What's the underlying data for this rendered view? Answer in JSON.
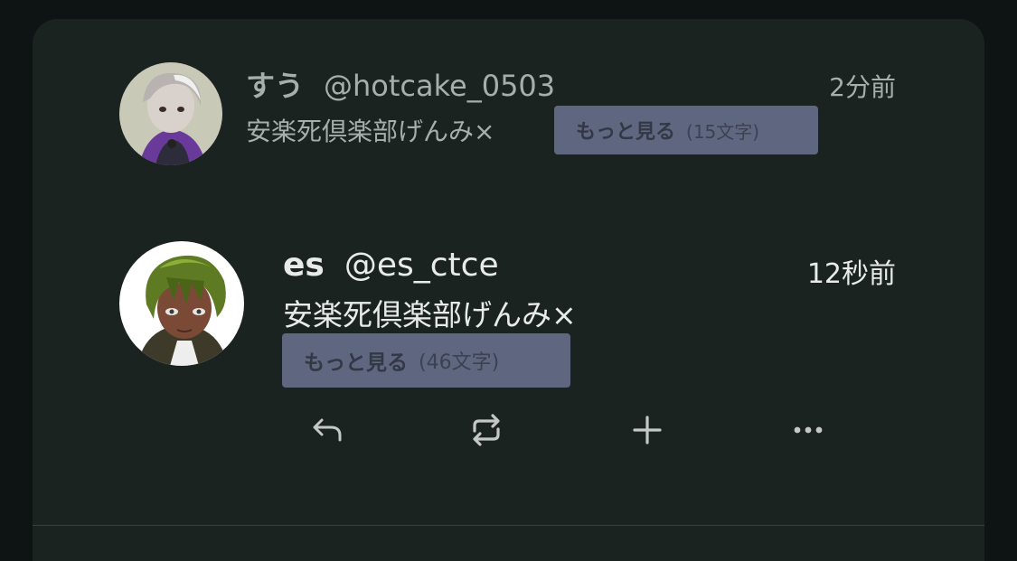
{
  "posts": [
    {
      "display_name": "すう",
      "handle": "@hotcake_0503",
      "time": "2分前",
      "text": "安楽死倶楽部げんみ×",
      "more_label": "もっと見る",
      "more_count": "(15文字)",
      "avatar_icon": "user-avatar-purple-jacket"
    },
    {
      "display_name": "es",
      "handle": "@es_ctce",
      "time": "12秒前",
      "text": "安楽死倶楽部げんみ×",
      "more_label": "もっと見る",
      "more_count": "(46文字)",
      "avatar_icon": "user-avatar-green-hair"
    }
  ],
  "actions": [
    {
      "name": "reply",
      "icon": "reply-icon"
    },
    {
      "name": "repost",
      "icon": "repost-icon"
    },
    {
      "name": "add",
      "icon": "plus-icon"
    },
    {
      "name": "more",
      "icon": "ellipsis-icon"
    }
  ],
  "colors": {
    "background": "#0e1413",
    "card": "#1b2321",
    "more_button": "#5f6780",
    "text_primary": "#e8ebea",
    "text_dimmed": "#a8aeab",
    "icon": "#c4c8c6"
  }
}
